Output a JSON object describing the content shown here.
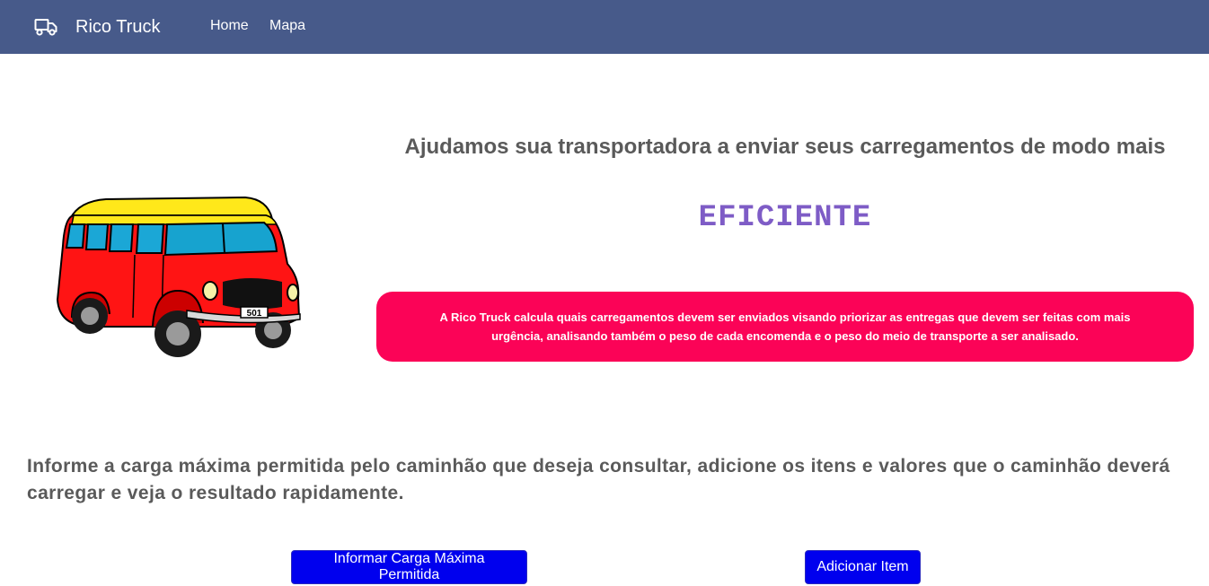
{
  "navbar": {
    "brand_name": "Rico Truck",
    "brand_icon": "truck-icon",
    "links": [
      {
        "label": "Home"
      },
      {
        "label": "Mapa"
      }
    ]
  },
  "hero": {
    "image_icon": "bus-illustration",
    "plate": "501",
    "title": "Ajudamos sua transportadora a enviar seus carregamentos de modo mais",
    "highlight": "EFICIENTE",
    "info_text": "A Rico Truck calcula quais carregamentos devem ser enviados visando priorizar as entregas que devem ser feitas com mais urgência, analisando também o peso de cada encomenda e o peso do meio de transporte a ser analisado."
  },
  "instruction": "Informe a carga máxima permitida pelo caminhão que deseja consultar, adicione os itens e valores que o caminhão deverá carregar e veja o resultado rapidamente.",
  "buttons": {
    "carga_label": "Informar Carga Máxima Permitida",
    "item_label": "Adicionar Item"
  },
  "colors": {
    "navbar": "#475a8a",
    "highlight": "#7e5cc6",
    "info_box": "#fb0357",
    "button": "#0000ee"
  }
}
